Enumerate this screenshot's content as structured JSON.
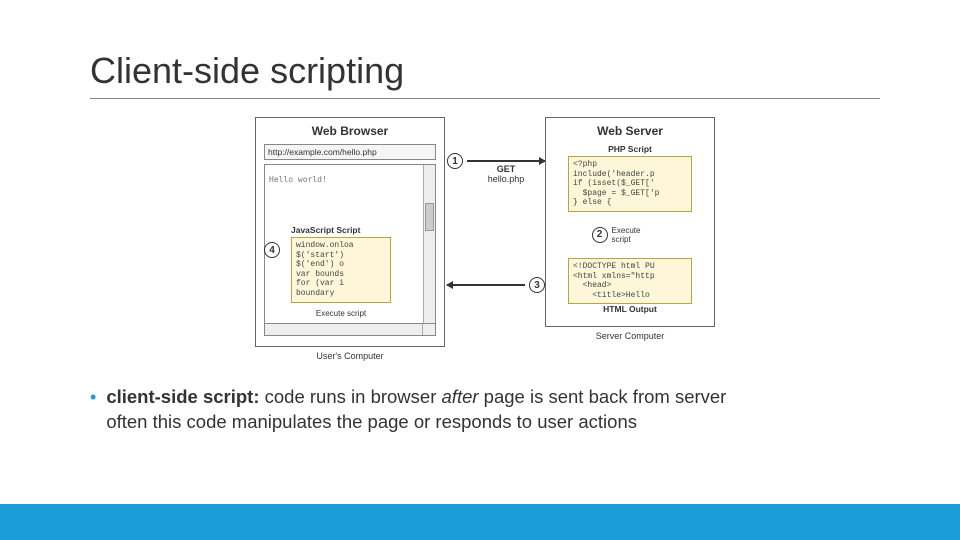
{
  "title": "Client-side scripting",
  "browser": {
    "panel_title": "Web Browser",
    "url": "http://example.com/hello.php",
    "hello": "Hello world!",
    "js_title": "JavaScript Script",
    "js_code": "window.onloa\n$('start')\n$('end') o\nvar bounds\nfor (var i\nboundary",
    "exec": "Execute script",
    "caption": "User's Computer"
  },
  "server": {
    "panel_title": "Web Server",
    "php_title": "PHP Script",
    "php_code": "<?php\ninclude('header.p\nif (isset($_GET['\n  $page = $_GET['p\n} else {",
    "html_title": "HTML Output",
    "html_code": "<!DOCTYPE html PU\n<html xmlns=\"http\n  <head>\n    <title>Hello",
    "exec": "Execute\nscript",
    "caption": "Server Computer"
  },
  "steps": {
    "s1": "1",
    "s2": "2",
    "s3": "3",
    "s4": "4",
    "get_label_top": "GET",
    "get_label_bottom": "hello.php"
  },
  "bullet": {
    "term": "client-side script:",
    "line1_rest": " code runs in browser ",
    "after": "after",
    "line1_tail": " page is sent back from server",
    "line2": "often this code manipulates the page or responds to user actions"
  }
}
